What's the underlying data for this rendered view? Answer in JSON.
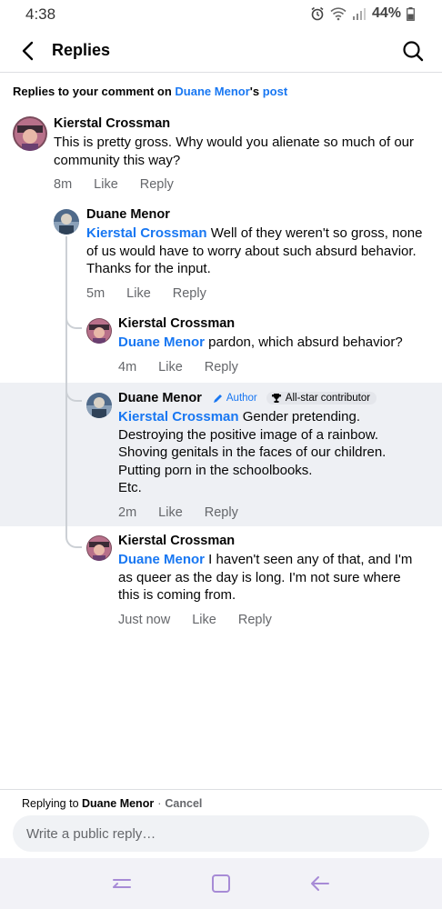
{
  "status": {
    "time": "4:38",
    "battery": "44%"
  },
  "header": {
    "title": "Replies"
  },
  "context": {
    "prefix": "Replies to your comment on ",
    "name": "Duane Menor",
    "possessive": "'s ",
    "post": "post"
  },
  "comments": [
    {
      "author": "Kierstal Crossman",
      "text": "This is pretty gross. Why would you alienate so much of our community this way?",
      "time": "8m",
      "like": "Like",
      "reply": "Reply"
    },
    {
      "author": "Duane Menor",
      "mention": "Kierstal Crossman",
      "text": " Well of they weren't so gross, none of us would have to worry about such absurd behavior. Thanks for the input.",
      "time": "5m",
      "like": "Like",
      "reply": "Reply"
    },
    {
      "author": "Kierstal Crossman",
      "mention": "Duane Menor",
      "text": " pardon, which absurd behavior?",
      "time": "4m",
      "like": "Like",
      "reply": "Reply"
    },
    {
      "author": "Duane Menor",
      "badge_author": "Author",
      "badge_star": "All-star contributor",
      "mention": "Kierstal Crossman",
      "lines": [
        " Gender pretending.",
        "Destroying the positive image of a rainbow.",
        "Shoving genitals in the faces of our children.",
        "Putting porn in the schoolbooks.",
        "Etc."
      ],
      "time": "2m",
      "like": "Like",
      "reply": "Reply"
    },
    {
      "author": "Kierstal Crossman",
      "mention": "Duane Menor",
      "text": " I haven't seen any of that, and I'm as queer as the day is long. I'm not sure where this is coming from.",
      "time": "Just now",
      "like": "Like",
      "reply": "Reply"
    }
  ],
  "footer": {
    "replying_prefix": "Replying to ",
    "replying_name": "Duane Menor",
    "separator": "·",
    "cancel": "Cancel",
    "placeholder": "Write a public reply…"
  },
  "colors": {
    "link": "#1877f2",
    "meta": "#65676b",
    "highlight": "#eef0f4"
  }
}
